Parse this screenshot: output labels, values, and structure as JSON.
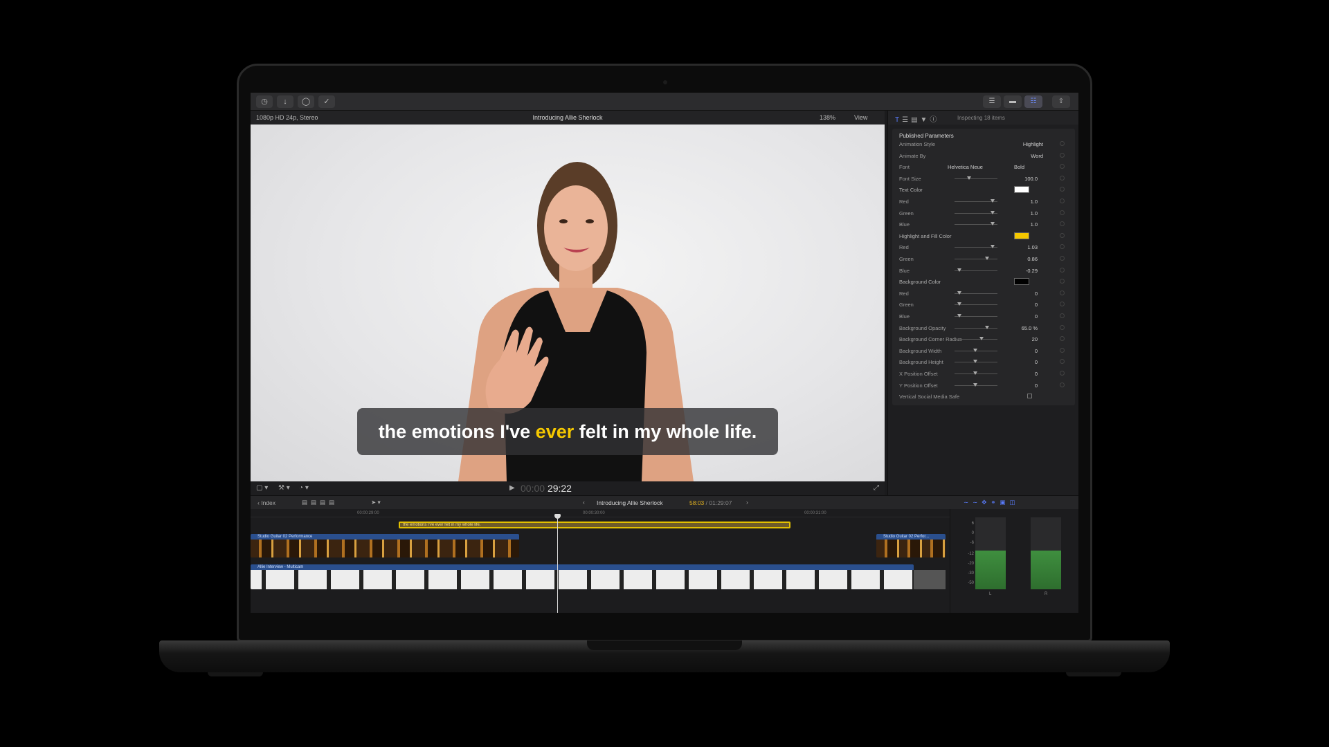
{
  "toolbar": {
    "left_icons": [
      "import-icon",
      "download-icon",
      "key-icon",
      "checkmark-icon"
    ],
    "right_icons": [
      "browser-icon",
      "timeline-icon",
      "inspector-icon",
      "share-icon"
    ]
  },
  "viewer": {
    "format": "1080p HD 24p, Stereo",
    "title": "Introducing Allie Sherlock",
    "zoom": "138%",
    "view_menu": "View",
    "caption_before": "the emotions I've",
    "caption_highlight": "ever",
    "caption_after": "felt in my whole life.",
    "timecode_dim": "00:00",
    "timecode": "29:22"
  },
  "inspector": {
    "inspecting": "Inspecting 18 items",
    "section": "Published Parameters",
    "rows": {
      "animation_style": {
        "label": "Animation Style",
        "value": "Highlight"
      },
      "animate_by": {
        "label": "Animate By",
        "value": "Word"
      },
      "font": {
        "label": "Font",
        "family": "Helvetica Neue",
        "weight": "Bold"
      },
      "font_size": {
        "label": "Font Size",
        "value": "100.0"
      },
      "text_color": {
        "label": "Text Color",
        "swatch": "#ffffff"
      },
      "text_red": {
        "label": "Red",
        "value": "1.0"
      },
      "text_green": {
        "label": "Green",
        "value": "1.0"
      },
      "text_blue": {
        "label": "Blue",
        "value": "1.0"
      },
      "hl_color": {
        "label": "Highlight and Fill Color",
        "swatch": "#f5c800"
      },
      "hl_red": {
        "label": "Red",
        "value": "1.03"
      },
      "hl_green": {
        "label": "Green",
        "value": "0.86"
      },
      "hl_blue": {
        "label": "Blue",
        "value": "-0.29"
      },
      "bg_color": {
        "label": "Background Color",
        "swatch": "#000000"
      },
      "bg_red": {
        "label": "Red",
        "value": "0"
      },
      "bg_green": {
        "label": "Green",
        "value": "0"
      },
      "bg_blue": {
        "label": "Blue",
        "value": "0"
      },
      "bg_opacity": {
        "label": "Background Opacity",
        "value": "65.0 %"
      },
      "bg_radius": {
        "label": "Background Corner Radius",
        "value": "20"
      },
      "bg_width": {
        "label": "Background Width",
        "value": "0"
      },
      "bg_height": {
        "label": "Background Height",
        "value": "0"
      },
      "x_offset": {
        "label": "X Position Offset",
        "value": "0"
      },
      "y_offset": {
        "label": "Y Position Offset",
        "value": "0"
      },
      "social_safe": {
        "label": "Vertical Social Media Safe"
      }
    }
  },
  "timeline": {
    "index": "Index",
    "project": "Introducing Allie Sherlock",
    "duration_current": "58:03",
    "duration_total": "/ 01:29:07",
    "ruler": [
      "00:00:29:00",
      "00:00:30:00",
      "00:00:31:00"
    ],
    "caption_clip": "the emotions I've ever felt in my whole life.",
    "clip_guitar": "Studio Guitar 02 Performance",
    "clip_guitar_short": "Studio Guitar 02 Perfor...",
    "clip_interview": "Allie Interview - Multicam",
    "meter_scale": [
      "6",
      "0",
      "-6",
      "-12",
      "-20",
      "-30",
      "-50"
    ],
    "meter_labels": [
      "L",
      "R"
    ]
  },
  "colors": {
    "accent": "#5a7dff",
    "highlight": "#f5c800",
    "caption_border": "#e3c000"
  }
}
